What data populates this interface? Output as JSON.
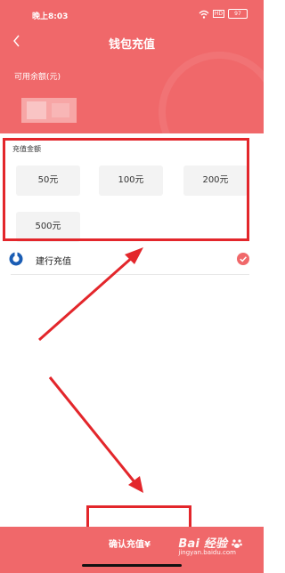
{
  "status_bar": {
    "time": "晚上8:03",
    "hd_badge": "HD",
    "battery_level": "97"
  },
  "navbar": {
    "title": "钱包充值"
  },
  "balance": {
    "label": "可用余额(元)",
    "value_masked": true
  },
  "recharge": {
    "section_title": "充值金额",
    "options": [
      {
        "label": "50元"
      },
      {
        "label": "100元"
      },
      {
        "label": "200元"
      },
      {
        "label": "500元"
      }
    ]
  },
  "payment": {
    "bank_name": "建行充值",
    "selected": true
  },
  "footer": {
    "confirm_label": "确认充值¥"
  },
  "watermark": {
    "brand": "Bai 经验",
    "sub": "jingyan.baidu.com"
  },
  "colors": {
    "header": "#f0686a",
    "accent": "#e3262b",
    "button_bg": "#f3f3f3",
    "bank_blue": "#1a5db4"
  }
}
